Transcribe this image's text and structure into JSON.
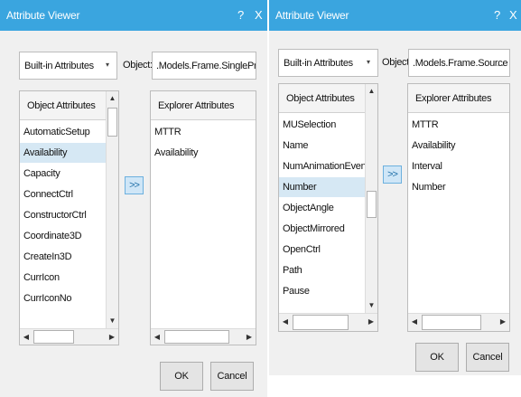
{
  "dialogs": [
    {
      "title": "Attribute Viewer",
      "help": "?",
      "close": "X",
      "attribute_set": "Built-in Attributes",
      "object_label": "Object:",
      "object_value": ".Models.Frame.SingleProc",
      "browse": "...",
      "left_header": "Object Attributes",
      "left_items": [
        "AutomaticSetup",
        "Availability",
        "Capacity",
        "ConnectCtrl",
        "ConstructorCtrl",
        "Coordinate3D",
        "CreateIn3D",
        "CurrIcon",
        "CurrIconNo"
      ],
      "left_selected": "Availability",
      "transfer": ">>",
      "right_header": "Explorer Attributes",
      "right_items": [
        "MTTR",
        "Availability"
      ],
      "ok": "OK",
      "cancel": "Cancel"
    },
    {
      "title": "Attribute Viewer",
      "help": "?",
      "close": "X",
      "attribute_set": "Built-in Attributes",
      "object_label": "Object:",
      "object_value": ".Models.Frame.Source",
      "browse": "...",
      "left_header": "Object Attributes",
      "left_items": [
        "MUSelection",
        "Name",
        "NumAnimationEvents",
        "Number",
        "ObjectAngle",
        "ObjectMirrored",
        "OpenCtrl",
        "Path",
        "Pause"
      ],
      "left_selected": "Number",
      "transfer": ">>",
      "right_header": "Explorer Attributes",
      "right_items": [
        "MTTR",
        "Availability",
        "Interval",
        "Number"
      ],
      "ok": "OK",
      "cancel": "Cancel"
    }
  ],
  "scroll_glyphs": {
    "up": "▲",
    "down": "▼",
    "left": "◀",
    "right": "▶",
    "dropdown": "▾"
  },
  "colors": {
    "titlebar": "#3aa5df",
    "selection": "#d6e8f4",
    "transfer_button": "#cfe6f7"
  }
}
